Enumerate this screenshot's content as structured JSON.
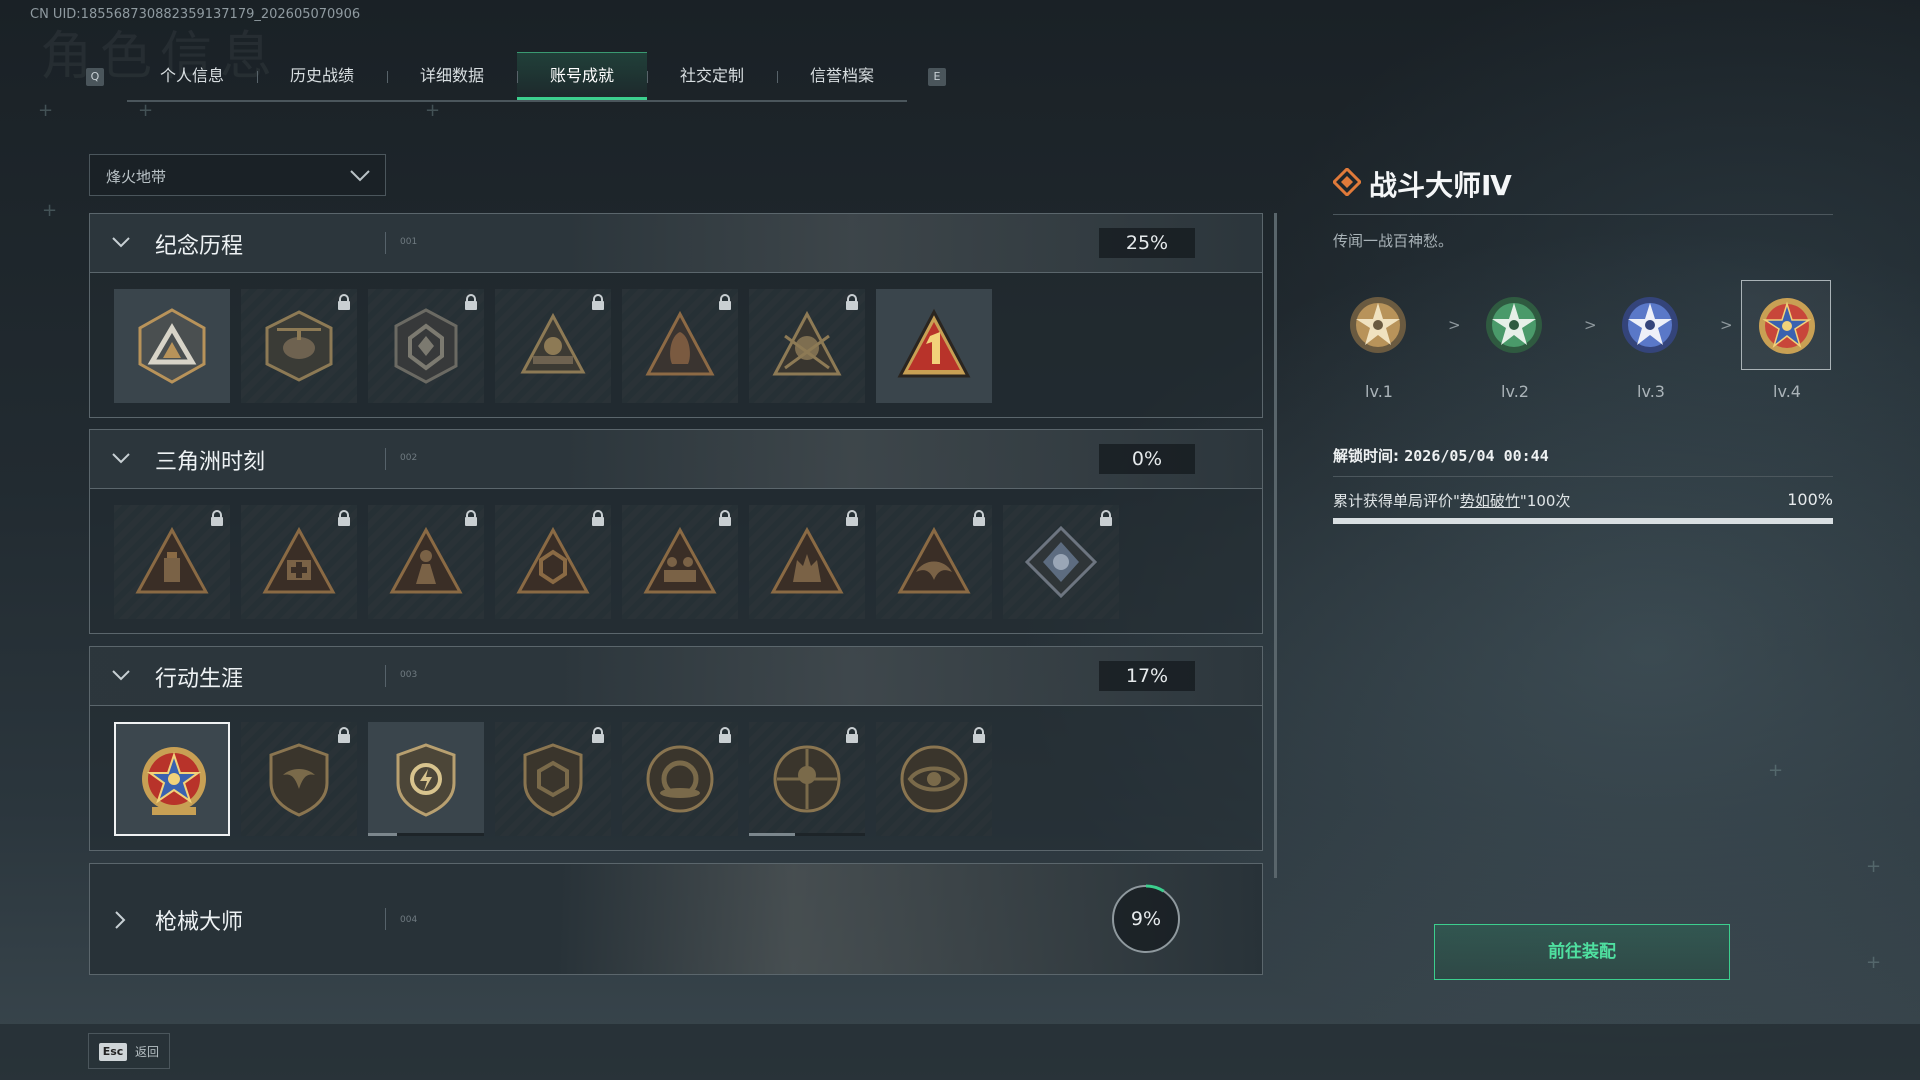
{
  "header": {
    "uid": "CN UID:18556873088235913717​9_202605070906",
    "bg_title": "角色信息"
  },
  "tabs": {
    "left_key": "Q",
    "right_key": "E",
    "items": [
      {
        "label": "个人信息"
      },
      {
        "label": "历史战绩"
      },
      {
        "label": "详细数据"
      },
      {
        "label": "账号成就",
        "active": true
      },
      {
        "label": "社交定制"
      },
      {
        "label": "信誉档案"
      }
    ]
  },
  "filter": {
    "selected": "烽火地带"
  },
  "sections": [
    {
      "name": "纪念历程",
      "num": "001",
      "percent": "25%",
      "expanded": true,
      "badges": [
        {
          "icon": "triangle-emblem-icon",
          "locked": false
        },
        {
          "icon": "helicopter-emblem-icon",
          "locked": true
        },
        {
          "icon": "shield-emblem-icon",
          "locked": true
        },
        {
          "icon": "soldier-emblem-icon",
          "locked": true
        },
        {
          "icon": "hooded-emblem-icon",
          "locked": true
        },
        {
          "icon": "skull-emblem-icon",
          "locked": true
        },
        {
          "icon": "number-one-emblem-icon",
          "locked": false
        }
      ]
    },
    {
      "name": "三角洲时刻",
      "num": "002",
      "percent": "0%",
      "expanded": true,
      "badges": [
        {
          "icon": "canister-emblem-icon",
          "locked": true
        },
        {
          "icon": "medkit-emblem-icon",
          "locked": true
        },
        {
          "icon": "figure-emblem-icon",
          "locked": true
        },
        {
          "icon": "hexagon-emblem-icon",
          "locked": true
        },
        {
          "icon": "squad-emblem-icon",
          "locked": true
        },
        {
          "icon": "wolf-emblem-icon",
          "locked": true
        },
        {
          "icon": "eagle-emblem-icon",
          "locked": true
        },
        {
          "icon": "crystal-emblem-icon",
          "locked": true
        }
      ]
    },
    {
      "name": "行动生涯",
      "num": "003",
      "percent": "17%",
      "expanded": true,
      "badges": [
        {
          "icon": "star-medal-icon",
          "locked": false,
          "selected": true
        },
        {
          "icon": "eagle-shield-icon",
          "locked": true
        },
        {
          "icon": "bolt-shield-icon",
          "locked": false,
          "progress": 0.25
        },
        {
          "icon": "hexagon-shield-icon",
          "locked": true
        },
        {
          "icon": "round-emblem-icon",
          "locked": true
        },
        {
          "icon": "target-emblem-icon",
          "locked": true,
          "progress": 0.4
        },
        {
          "icon": "eye-emblem-icon",
          "locked": true
        }
      ]
    },
    {
      "name": "枪械大师",
      "num": "004",
      "percent": "9%",
      "progress": 0.09,
      "expanded": false
    }
  ],
  "detail": {
    "title": "战斗大师Ⅳ",
    "description": "传闻一战百神愁。",
    "levels": [
      {
        "label": "lv.1",
        "color": "#b8935a"
      },
      {
        "label": "lv.2",
        "color": "#4a9a6a"
      },
      {
        "label": "lv.3",
        "color": "#5a78c8"
      },
      {
        "label": "lv.4",
        "color": "#c8463a",
        "current": true
      }
    ],
    "arrow": ">",
    "unlock_label": "解锁时间: ",
    "unlock_time": "2026/05/04 00:44",
    "condition_prefix": "累计获得单局评价\"",
    "condition_link": "势如破竹",
    "condition_suffix": "\"100次",
    "condition_percent": "100%",
    "condition_progress": 1.0
  },
  "equip_button": "前往装配",
  "footer": {
    "esc_key": "Esc",
    "esc_label": "返回"
  },
  "colors": {
    "accent": "#3ccf8e",
    "gold": "#b8935a"
  }
}
